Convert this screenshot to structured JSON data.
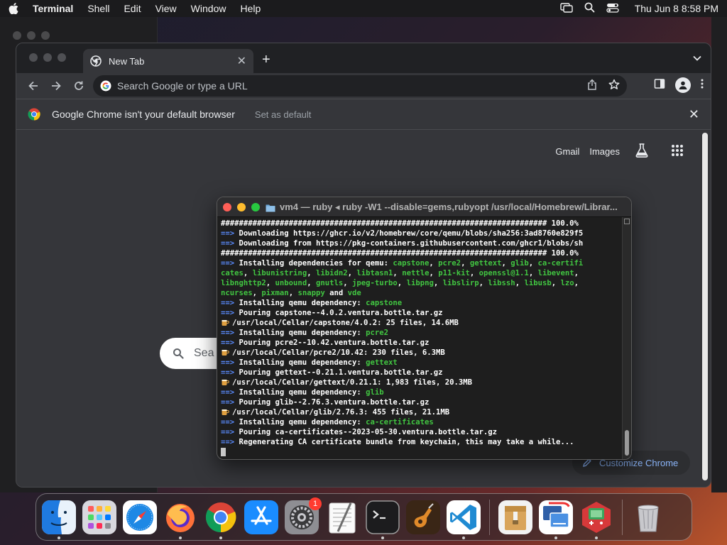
{
  "menubar": {
    "app_name": "Terminal",
    "items": [
      "Shell",
      "Edit",
      "View",
      "Window",
      "Help"
    ],
    "clock": "Thu Jun 8  8:58 PM"
  },
  "chrome": {
    "tab_title": "New Tab",
    "omnibox_placeholder": "Search Google or type a URL",
    "infobar_message": "Google Chrome isn't your default browser",
    "infobar_action": "Set as default",
    "links": {
      "gmail": "Gmail",
      "images": "Images"
    },
    "search_partial": "Sea",
    "customize_label": "Customize Chrome"
  },
  "terminal": {
    "title": "vm4 — ruby ◂ ruby -W1 --disable=gems,rubyopt /usr/local/Homebrew/Librar...",
    "lines": [
      [
        {
          "t": "######################################################################## 100.0%",
          "c": "white"
        }
      ],
      [
        {
          "t": "==> ",
          "c": "arrow"
        },
        {
          "t": "Downloading https://ghcr.io/v2/homebrew/core/qemu/blobs/sha256:3ad8760e829f5",
          "c": "white"
        }
      ],
      [
        {
          "t": "==> ",
          "c": "arrow"
        },
        {
          "t": "Downloading from https://pkg-containers.githubusercontent.com/ghcr1/blobs/sh",
          "c": "white"
        }
      ],
      [
        {
          "t": "######################################################################## 100.0%",
          "c": "white"
        }
      ],
      [
        {
          "t": "==> ",
          "c": "arrow"
        },
        {
          "t": "Installing dependencies for qemu: ",
          "c": "white"
        },
        {
          "t": "capstone",
          "c": "green"
        },
        {
          "t": ", ",
          "c": "white"
        },
        {
          "t": "pcre2",
          "c": "green"
        },
        {
          "t": ", ",
          "c": "white"
        },
        {
          "t": "gettext",
          "c": "green"
        },
        {
          "t": ", ",
          "c": "white"
        },
        {
          "t": "glib",
          "c": "green"
        },
        {
          "t": ", ",
          "c": "white"
        },
        {
          "t": "ca-certifi",
          "c": "green"
        }
      ],
      [
        {
          "t": "cates",
          "c": "green"
        },
        {
          "t": ", ",
          "c": "white"
        },
        {
          "t": "libunistring",
          "c": "green"
        },
        {
          "t": ", ",
          "c": "white"
        },
        {
          "t": "libidn2",
          "c": "green"
        },
        {
          "t": ", ",
          "c": "white"
        },
        {
          "t": "libtasn1",
          "c": "green"
        },
        {
          "t": ", ",
          "c": "white"
        },
        {
          "t": "nettle",
          "c": "green"
        },
        {
          "t": ", ",
          "c": "white"
        },
        {
          "t": "p11-kit",
          "c": "green"
        },
        {
          "t": ", ",
          "c": "white"
        },
        {
          "t": "openssl@1.1",
          "c": "green"
        },
        {
          "t": ", ",
          "c": "white"
        },
        {
          "t": "libevent",
          "c": "green"
        },
        {
          "t": ",",
          "c": "white"
        }
      ],
      [
        {
          "t": "libnghttp2",
          "c": "green"
        },
        {
          "t": ", ",
          "c": "white"
        },
        {
          "t": "unbound",
          "c": "green"
        },
        {
          "t": ", ",
          "c": "white"
        },
        {
          "t": "gnutls",
          "c": "green"
        },
        {
          "t": ", ",
          "c": "white"
        },
        {
          "t": "jpeg-turbo",
          "c": "green"
        },
        {
          "t": ", ",
          "c": "white"
        },
        {
          "t": "libpng",
          "c": "green"
        },
        {
          "t": ", ",
          "c": "white"
        },
        {
          "t": "libslirp",
          "c": "green"
        },
        {
          "t": ", ",
          "c": "white"
        },
        {
          "t": "libssh",
          "c": "green"
        },
        {
          "t": ", ",
          "c": "white"
        },
        {
          "t": "libusb",
          "c": "green"
        },
        {
          "t": ", ",
          "c": "white"
        },
        {
          "t": "lzo",
          "c": "green"
        },
        {
          "t": ",",
          "c": "white"
        }
      ],
      [
        {
          "t": "ncurses",
          "c": "green"
        },
        {
          "t": ", ",
          "c": "white"
        },
        {
          "t": "pixman",
          "c": "green"
        },
        {
          "t": ", ",
          "c": "white"
        },
        {
          "t": "snappy",
          "c": "green"
        },
        {
          "t": " and ",
          "c": "white"
        },
        {
          "t": "vde",
          "c": "green"
        }
      ],
      [
        {
          "t": "==> ",
          "c": "arrow"
        },
        {
          "t": "Installing qemu dependency: ",
          "c": "white"
        },
        {
          "t": "capstone",
          "c": "green"
        }
      ],
      [
        {
          "t": "==> ",
          "c": "arrow"
        },
        {
          "t": "Pouring capstone--4.0.2.ventura.bottle.tar.gz",
          "c": "white"
        }
      ],
      [
        {
          "t": "MUG",
          "c": "mug"
        },
        {
          "t": "/usr/local/Cellar/capstone/4.0.2: 25 files, 14.6MB",
          "c": "white"
        }
      ],
      [
        {
          "t": "==> ",
          "c": "arrow"
        },
        {
          "t": "Installing qemu dependency: ",
          "c": "white"
        },
        {
          "t": "pcre2",
          "c": "green"
        }
      ],
      [
        {
          "t": "==> ",
          "c": "arrow"
        },
        {
          "t": "Pouring pcre2--10.42.ventura.bottle.tar.gz",
          "c": "white"
        }
      ],
      [
        {
          "t": "MUG",
          "c": "mug"
        },
        {
          "t": "/usr/local/Cellar/pcre2/10.42: 230 files, 6.3MB",
          "c": "white"
        }
      ],
      [
        {
          "t": "==> ",
          "c": "arrow"
        },
        {
          "t": "Installing qemu dependency: ",
          "c": "white"
        },
        {
          "t": "gettext",
          "c": "green"
        }
      ],
      [
        {
          "t": "==> ",
          "c": "arrow"
        },
        {
          "t": "Pouring gettext--0.21.1.ventura.bottle.tar.gz",
          "c": "white"
        }
      ],
      [
        {
          "t": "MUG",
          "c": "mug"
        },
        {
          "t": "/usr/local/Cellar/gettext/0.21.1: 1,983 files, 20.3MB",
          "c": "white"
        }
      ],
      [
        {
          "t": "==> ",
          "c": "arrow"
        },
        {
          "t": "Installing qemu dependency: ",
          "c": "white"
        },
        {
          "t": "glib",
          "c": "green"
        }
      ],
      [
        {
          "t": "==> ",
          "c": "arrow"
        },
        {
          "t": "Pouring glib--2.76.3.ventura.bottle.tar.gz",
          "c": "white"
        }
      ],
      [
        {
          "t": "MUG",
          "c": "mug"
        },
        {
          "t": "/usr/local/Cellar/glib/2.76.3: 455 files, 21.1MB",
          "c": "white"
        }
      ],
      [
        {
          "t": "==> ",
          "c": "arrow"
        },
        {
          "t": "Installing qemu dependency: ",
          "c": "white"
        },
        {
          "t": "ca-certificates",
          "c": "green"
        }
      ],
      [
        {
          "t": "==> ",
          "c": "arrow"
        },
        {
          "t": "Pouring ca-certificates--2023-05-30.ventura.bottle.tar.gz",
          "c": "white"
        }
      ],
      [
        {
          "t": "==> ",
          "c": "arrow"
        },
        {
          "t": "Regenerating CA certificate bundle from keychain, this may take a while...",
          "c": "white"
        }
      ],
      [
        {
          "t": "CURSOR",
          "c": "cursor"
        }
      ]
    ]
  },
  "dock": {
    "apps": [
      {
        "name": "finder",
        "bg": "#2f7fe8",
        "running": true
      },
      {
        "name": "launchpad",
        "bg": "#c9c9cf",
        "running": false
      },
      {
        "name": "safari",
        "bg": "#1e88e5",
        "running": false
      },
      {
        "name": "firefox",
        "bg": "#7b3fd6",
        "running": true
      },
      {
        "name": "chrome",
        "bg": "#ffffff",
        "running": true
      },
      {
        "name": "app-store",
        "bg": "#1a8cff",
        "running": false
      },
      {
        "name": "system-settings",
        "bg": "#8e8e93",
        "running": false,
        "badge": "1"
      },
      {
        "name": "textedit",
        "bg": "#f4f4f4",
        "running": false
      },
      {
        "name": "terminal",
        "bg": "#1c1c1e",
        "running": true
      },
      {
        "name": "garageband",
        "bg": "#6b3b1e",
        "running": false
      },
      {
        "name": "vscode",
        "bg": "#ffffff",
        "running": true
      },
      {
        "name": "archive-utility",
        "bg": "#f0f0f0",
        "running": false
      },
      {
        "name": "migration-assistant",
        "bg": "#ffffff",
        "running": true
      },
      {
        "name": "game-emulator",
        "bg": "#d7393a",
        "running": true
      },
      {
        "name": "trash",
        "bg": "transparent",
        "running": false
      }
    ]
  }
}
